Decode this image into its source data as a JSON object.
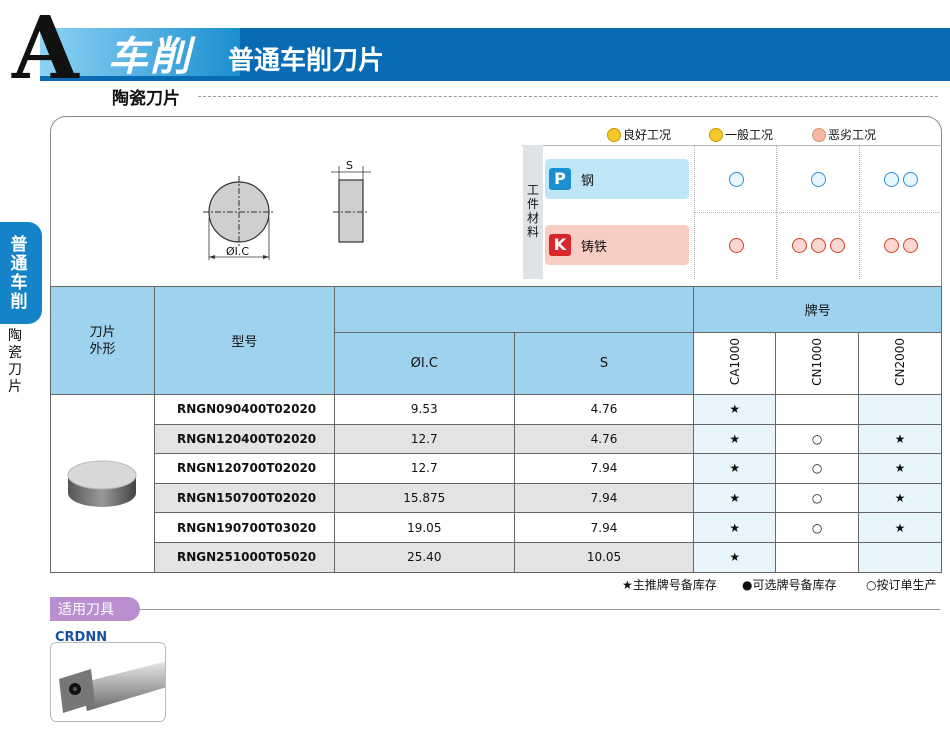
{
  "header": {
    "letter": "A",
    "category": "车削",
    "title": "普通车削刀片",
    "subtitle": "陶瓷刀片"
  },
  "side_tab": {
    "main": "普通车削",
    "sub": "陶瓷刀片"
  },
  "insert_drawing": {
    "dim_diameter": "ØI.C",
    "dim_thickness": "S"
  },
  "conditions": {
    "good": "良好工况",
    "normal": "一般工况",
    "bad": "恶劣工况"
  },
  "material_label": "工件材料",
  "materials": [
    {
      "code": "P",
      "name": "钢",
      "color": "#1b8fd0"
    },
    {
      "code": "K",
      "name": "铸铁",
      "color": "#d8262a"
    }
  ],
  "table": {
    "col_shape": "刀片外形",
    "col_model": "型号",
    "col_ic": "ØI.C",
    "col_s": "S",
    "col_grade": "牌号",
    "grades": [
      "CA1000",
      "CN1000",
      "CN2000"
    ],
    "rows": [
      {
        "model": "RNGN090400T02020",
        "ic": "9.53",
        "s": "4.76",
        "g1": "★",
        "g2": "",
        "g3": ""
      },
      {
        "model": "RNGN120400T02020",
        "ic": "12.7",
        "s": "4.76",
        "g1": "★",
        "g2": "○",
        "g3": "★"
      },
      {
        "model": "RNGN120700T02020",
        "ic": "12.7",
        "s": "7.94",
        "g1": "★",
        "g2": "○",
        "g3": "★"
      },
      {
        "model": "RNGN150700T02020",
        "ic": "15.875",
        "s": "7.94",
        "g1": "★",
        "g2": "○",
        "g3": "★"
      },
      {
        "model": "RNGN190700T03020",
        "ic": "19.05",
        "s": "7.94",
        "g1": "★",
        "g2": "○",
        "g3": "★"
      },
      {
        "model": "RNGN251000T05020",
        "ic": "25.40",
        "s": "10.05",
        "g1": "★",
        "g2": "",
        "g3": ""
      }
    ]
  },
  "legend": {
    "main": "★主推牌号备库存",
    "optional": "●可选牌号备库存",
    "order": "○按订单生产"
  },
  "tools": {
    "title": "适用刀具",
    "holder": "CRDNN"
  }
}
